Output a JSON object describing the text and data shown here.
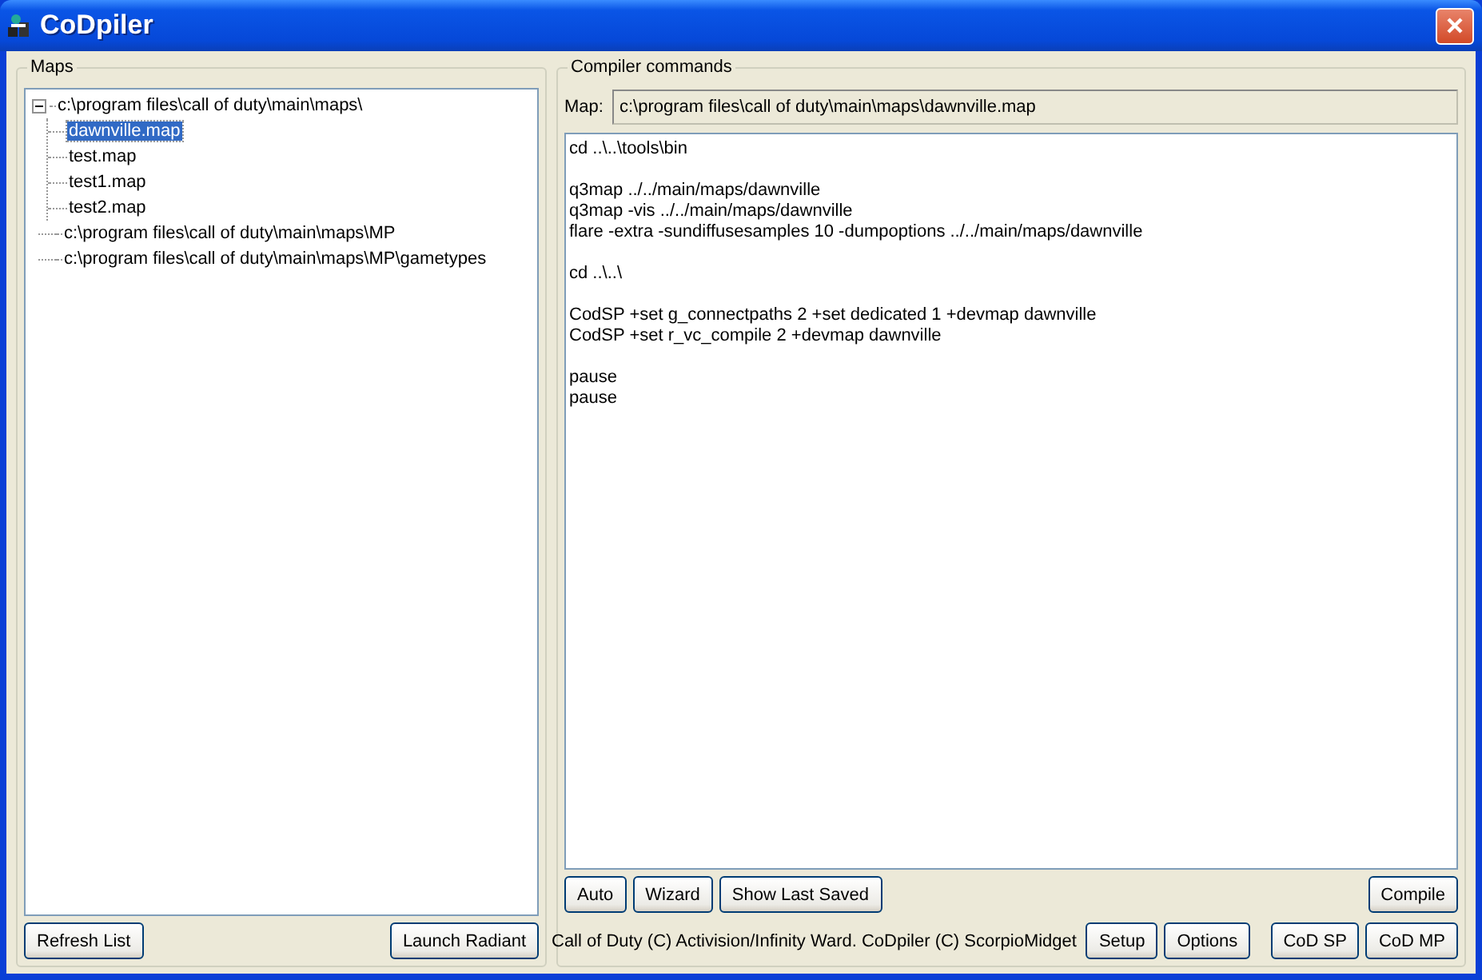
{
  "window": {
    "title": "CoDpiler"
  },
  "maps": {
    "label": "Maps",
    "tree": [
      {
        "label": "c:\\program files\\call of duty\\main\\maps\\",
        "expanded": true,
        "selected": false,
        "children": [
          {
            "label": "dawnville.map",
            "selected": true
          },
          {
            "label": "test.map",
            "selected": false
          },
          {
            "label": "test1.map",
            "selected": false
          },
          {
            "label": "test2.map",
            "selected": false
          }
        ]
      },
      {
        "label": "c:\\program files\\call of duty\\main\\maps\\MP",
        "selected": false
      },
      {
        "label": "c:\\program files\\call of duty\\main\\maps\\MP\\gametypes",
        "selected": false
      }
    ],
    "buttons": [
      "Refresh List",
      "Launch Radiant"
    ]
  },
  "compiler": {
    "label": "Compiler commands",
    "map_label": "Map:",
    "map_value": "c:\\program files\\call of duty\\main\\maps\\dawnville.map",
    "command_blocks": [
      [
        "cd ..\\..\\tools\\bin"
      ],
      [
        "q3map ../../main/maps/dawnville",
        "q3map -vis ../../main/maps/dawnville",
        "flare -extra -sundiffusesamples 10 -dumpoptions ../../main/maps/dawnville"
      ],
      [
        "cd ..\\..\\"
      ],
      [
        "CodSP +set g_connectpaths 2 +set dedicated 1 +devmap dawnville",
        "CodSP +set r_vc_compile 2 +devmap dawnville"
      ],
      [
        "pause",
        "pause"
      ]
    ],
    "buttons": [
      "Auto",
      "Wizard",
      "Show Last Saved"
    ],
    "compile_button": "Compile"
  },
  "status_bar": {
    "text": "Call of Duty (C) Activision/Infinity Ward. CoDpiler (C) ScorpioMidget",
    "buttons": [
      "Setup",
      "Options"
    ],
    "launch_buttons": [
      "CoD SP",
      "CoD MP"
    ]
  }
}
